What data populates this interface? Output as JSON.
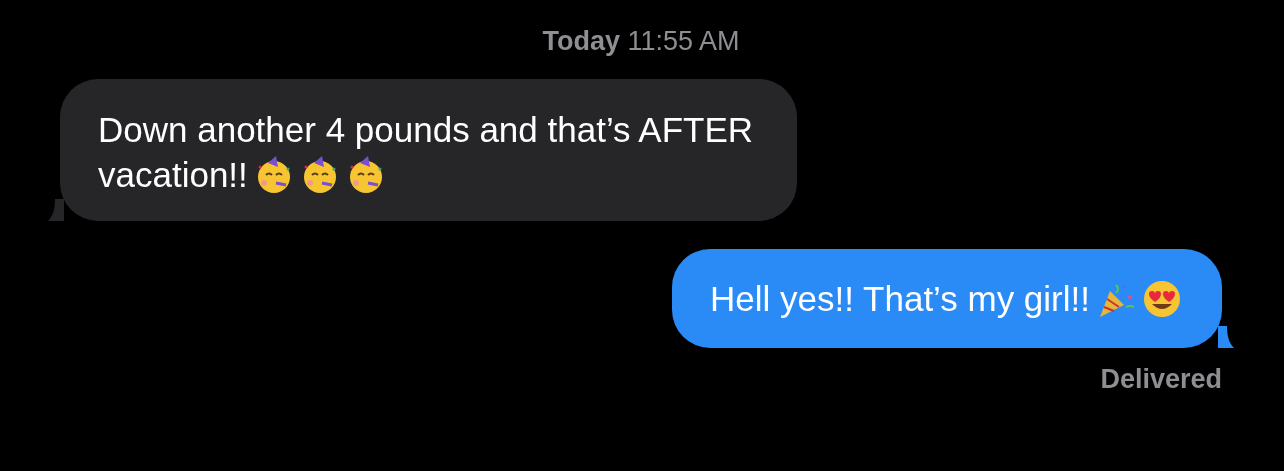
{
  "timestamp": "**Today** 11:55 AM",
  "messages": [
    {
      "sent": false,
      "lines": [
        "Down another 4 pounds and that’s AFTER",
        "vacation!!"
      ],
      "emojis": [
        {
          "kind": "party-face"
        },
        {
          "kind": "party-face"
        },
        {
          "kind": "party-face"
        }
      ]
    },
    {
      "sent": true,
      "lines": [
        "Hell yes!! That’s my girl!!"
      ],
      "emojis": [
        {
          "kind": "party-popper"
        },
        {
          "kind": "heart-eyes"
        }
      ]
    }
  ],
  "status": "Delivered"
}
